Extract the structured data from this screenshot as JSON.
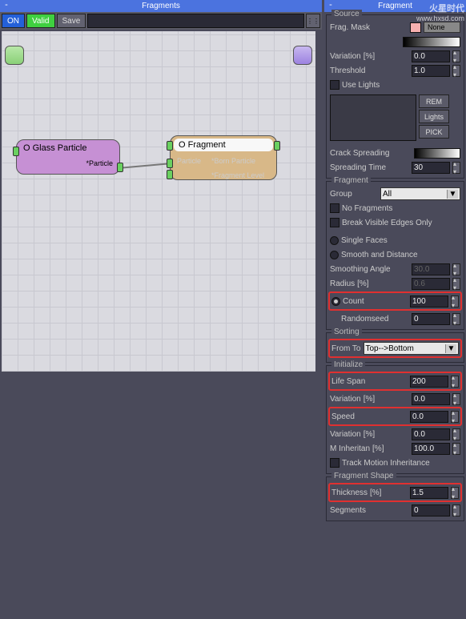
{
  "watermark": {
    "brand": "火星时代",
    "url": "www.hxsd.com"
  },
  "left": {
    "title": "Fragments",
    "toolbar": {
      "on": "ON",
      "valid": "Valid",
      "save": "Save"
    },
    "nodes": {
      "glass": {
        "title": "O Glass Particle",
        "sub": "*Particle"
      },
      "frag": {
        "title": "O Fragment",
        "col1": "Particle",
        "r1": "*Born Particle",
        "r2": "*Fragment Level"
      }
    }
  },
  "right": {
    "title": "Fragment",
    "source": {
      "title": "Source",
      "frag_mask": "Frag. Mask",
      "none": "None",
      "variation": "Variation",
      "pct": "[%]",
      "var_v": "0.0",
      "threshold": "Threshold",
      "th_v": "1.0",
      "use_lights": "Use Lights",
      "rem": "REM",
      "lights": "Lights",
      "pick": "PICK",
      "crack": "Crack Spreading",
      "spread_time": "Spreading Time",
      "spread_v": "30"
    },
    "fragment": {
      "title": "Fragment",
      "group": "Group",
      "group_v": "All",
      "no_frag": "No Fragments",
      "break_vis": "Break Visible Edges Only",
      "single": "Single Faces",
      "smooth": "Smooth and Distance",
      "sm_angle": "Smoothing Angle",
      "sm_v": "30.0",
      "radius": "Radius",
      "rad_v": "0.6",
      "count": "Count",
      "count_v": "100",
      "randseed": "Randomseed",
      "rs_v": "0"
    },
    "sorting": {
      "title": "Sorting",
      "from_to": "From To",
      "ft_v": "Top-->Bottom"
    },
    "init": {
      "title": "Initialize",
      "life": "Life Span",
      "life_v": "200",
      "variation": "Variation",
      "pct": "[%]",
      "var_v": "0.0",
      "speed": "Speed",
      "speed_v": "0.0",
      "var2_v": "0.0",
      "minh": "M Inheritan",
      "minh_v": "100.0",
      "track": "Track Motion Inheritance"
    },
    "shape": {
      "title": "Fragment Shape",
      "thick": "Thickness",
      "pct": "[%]",
      "thick_v": "1.5",
      "seg": "Segments",
      "seg_v": "0"
    }
  }
}
